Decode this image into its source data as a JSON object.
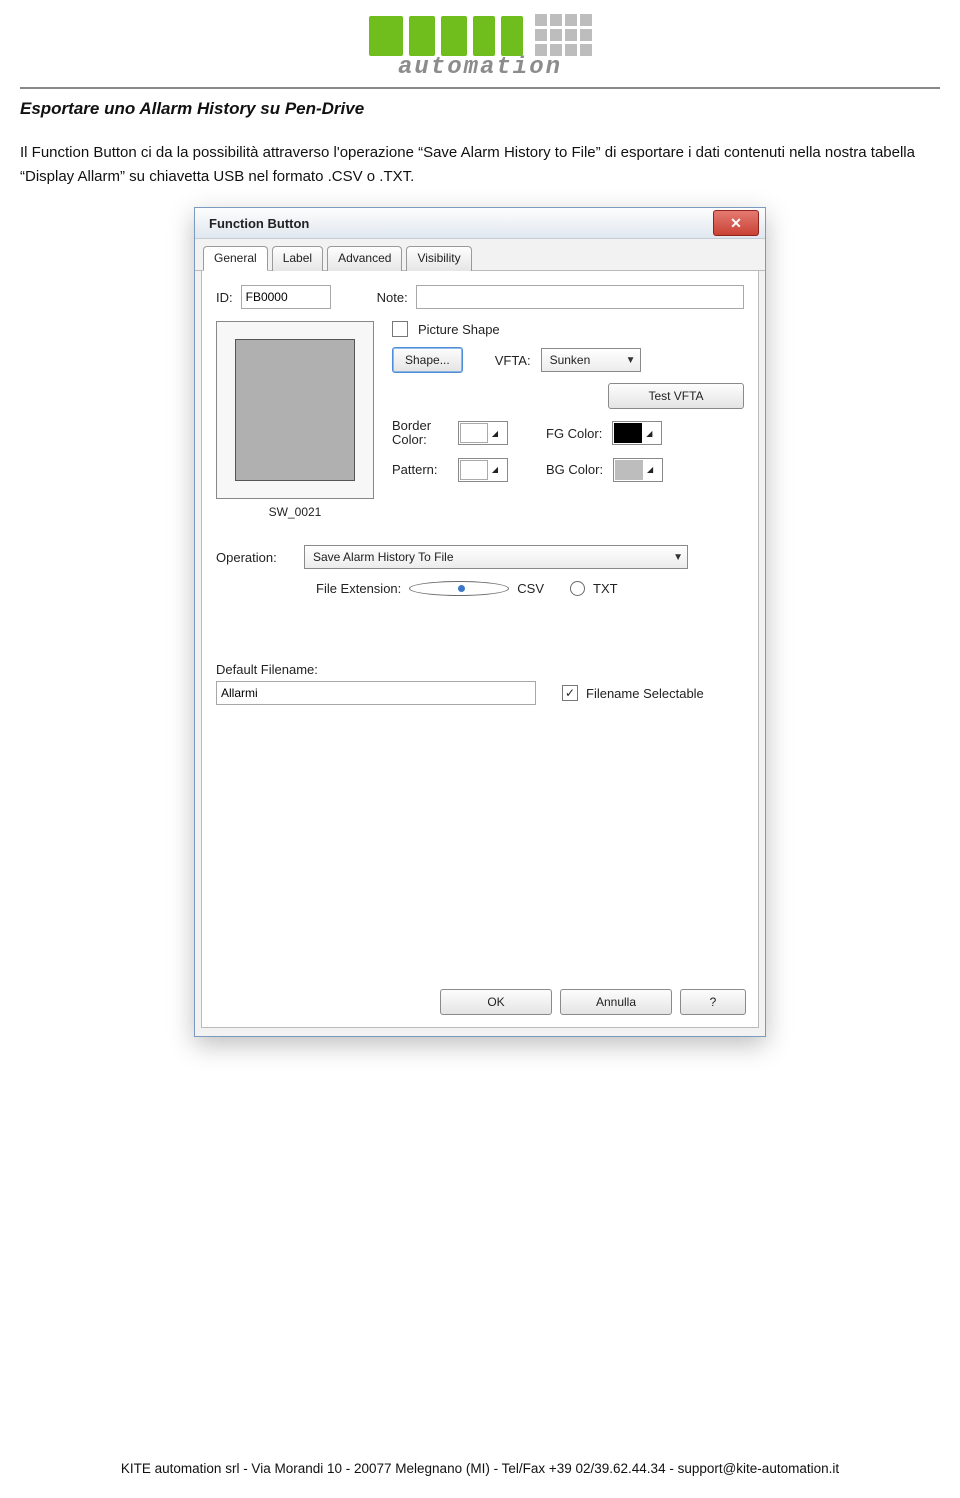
{
  "logo": {
    "bottom": "automation"
  },
  "doc": {
    "title": "Esportare uno Allarm History su Pen-Drive",
    "paragraph": "Il Function Button ci da la possibilità attraverso l'operazione “Save Alarm History to File” di esportare i dati contenuti nella nostra tabella “Display Allarm” su chiavetta USB nel formato .CSV o .TXT."
  },
  "dialog": {
    "title": "Function Button",
    "tabs": {
      "general": "General",
      "label": "Label",
      "advanced": "Advanced",
      "visibility": "Visibility"
    },
    "id_label": "ID:",
    "id_value": "FB0000",
    "note_label": "Note:",
    "note_value": "",
    "preview_label": "SW_0021",
    "picture_shape": "Picture Shape",
    "shape_btn": "Shape...",
    "vfta_label": "VFTA:",
    "vfta_value": "Sunken",
    "test_vfta": "Test VFTA",
    "border_color": "Border Color:",
    "fg_color": "FG Color:",
    "pattern": "Pattern:",
    "bg_color": "BG Color:",
    "operation": "Operation:",
    "operation_value": "Save Alarm History To File",
    "file_ext": "File Extension:",
    "ext_csv": "CSV",
    "ext_txt": "TXT",
    "default_filename": "Default Filename:",
    "filename_value": "Allarmi",
    "filename_selectable": "Filename Selectable",
    "ok": "OK",
    "cancel": "Annulla",
    "help": "?"
  },
  "footer": "KITE automation srl - Via Morandi 10 - 20077 Melegnano (MI) - Tel/Fax +39 02/39.62.44.34 - support@kite-automation.it"
}
